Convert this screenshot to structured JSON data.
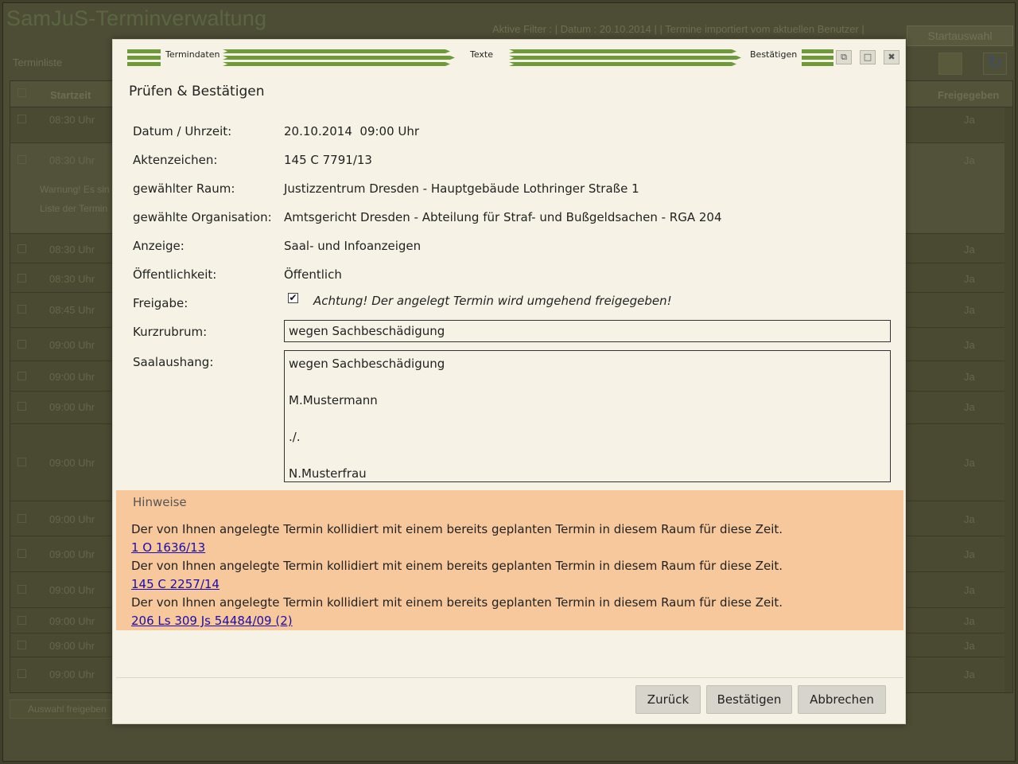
{
  "background_app": {
    "title": "SamJuS-Terminverwaltung",
    "filter_status": "Aktive Filter : | Datum : 20.10.2014 | | Termine importiert vom aktuellen Benutzer |",
    "start_button": "Startauswahl",
    "list_label": "Terminliste",
    "columns": {
      "start": "Startzeit",
      "freigegeben": "Freigegeben"
    },
    "rows": [
      {
        "time": "08:30 Uhr",
        "freigegeben": "Ja"
      },
      {
        "time": "08:30 Uhr",
        "freigegeben": "Ja"
      },
      {
        "time": "08:30 Uhr",
        "freigegeben": "Ja"
      },
      {
        "time": "08:30 Uhr",
        "freigegeben": "Ja"
      },
      {
        "time": "08:45 Uhr",
        "freigegeben": "Ja"
      },
      {
        "time": "09:00 Uhr",
        "freigegeben": "Ja"
      },
      {
        "time": "09:00 Uhr",
        "freigegeben": "Ja"
      },
      {
        "time": "09:00 Uhr",
        "freigegeben": "Ja"
      },
      {
        "time": "09:00 Uhr",
        "freigegeben": "Ja"
      },
      {
        "time": "09:00 Uhr",
        "freigegeben": "Ja"
      },
      {
        "time": "09:00 Uhr",
        "freigegeben": "Ja"
      },
      {
        "time": "09:00 Uhr",
        "freigegeben": "Ja"
      },
      {
        "time": "09:00 Uhr",
        "freigegeben": "Ja"
      },
      {
        "time": "09:00 Uhr",
        "freigegeben": "Ja"
      },
      {
        "time": "09:00 Uhr",
        "freigegeben": "Ja"
      }
    ],
    "warning_line_1": "Warnung! Es sin",
    "warning_line_2": "Liste der Termin",
    "bottom_button": "Auswahl freigeben"
  },
  "wizard": {
    "steps": [
      "Termindaten",
      "Texte",
      "Bestätigen"
    ],
    "accent_color": "#6e9a3c"
  },
  "dialog": {
    "title": "Prüfen & Bestätigen",
    "fields": {
      "datum_label": "Datum / Uhrzeit:",
      "datum_value": "20.10.2014  09:00 Uhr",
      "aktenzeichen_label": "Aktenzeichen:",
      "aktenzeichen_value": "145 C 7791/13",
      "raum_label": "gewählter Raum:",
      "raum_value": "Justizzentrum Dresden - Hauptgebäude Lothringer Straße 1",
      "organisation_label": "gewählte Organisation:",
      "organisation_value": "Amtsgericht Dresden - Abteilung für Straf- und Bußgeldsachen - RGA 204",
      "anzeige_label": "Anzeige:",
      "anzeige_value": "Saal- und Infoanzeigen",
      "oeffentlichkeit_label": "Öffentlichkeit:",
      "oeffentlichkeit_value": "Öffentlich",
      "freigabe_label": "Freigabe:",
      "freigabe_note": "Achtung! Der angelegt Termin wird umgehend freigegeben!",
      "kurzrubrum_label": "Kurzrubrum:",
      "kurzrubrum_value": "wegen Sachbeschädigung",
      "saalaushang_label": "Saalaushang:",
      "saalaushang_lines": [
        "wegen Sachbeschädigung",
        "",
        "M.Mustermann",
        "",
        "./.",
        "",
        "N.Musterfrau"
      ]
    },
    "hinweise": {
      "title": "Hinweise",
      "background_color": "#f7c89c",
      "items": [
        {
          "message": "Der von Ihnen angelegte Termin kollidiert mit einem bereits geplanten Termin in diesem Raum für diese Zeit.",
          "link": "1 O 1636/13"
        },
        {
          "message": "Der von Ihnen angelegte Termin kollidiert mit einem bereits geplanten Termin in diesem Raum für diese Zeit.",
          "link": "145 C 2257/14"
        },
        {
          "message": "Der von Ihnen angelegte Termin kollidiert mit einem bereits geplanten Termin in diesem Raum für diese Zeit.",
          "link": "206 Ls 309 Js 54484/09 (2)"
        }
      ]
    },
    "buttons": {
      "back": "Zurück",
      "confirm": "Bestätigen",
      "cancel": "Abbrechen"
    },
    "window_icons": [
      "restore-icon",
      "maximize-icon",
      "close-icon"
    ]
  }
}
